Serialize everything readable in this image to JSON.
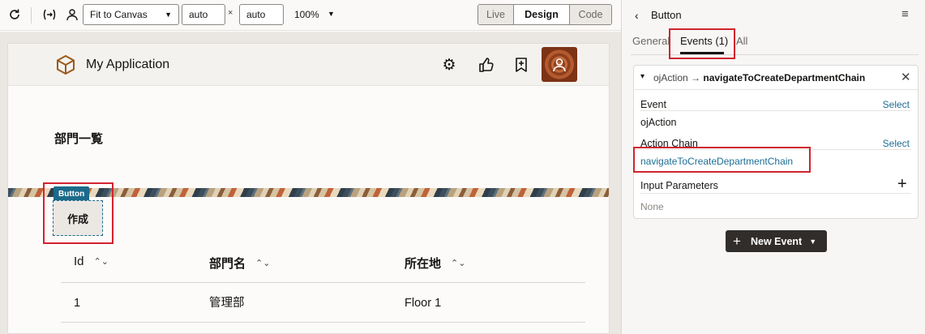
{
  "toolbar": {
    "fit_mode": "Fit to Canvas",
    "width_value": "auto",
    "height_value": "auto",
    "times_symbol": "×",
    "zoom": "100%",
    "modes": [
      "Live",
      "Design",
      "Code"
    ],
    "active_mode": "Design"
  },
  "app": {
    "title": "My Application",
    "page_heading": "部門一覧",
    "button_tag": "Button",
    "create_button": "作成",
    "table": {
      "columns": [
        "Id",
        "部門名",
        "所在地"
      ],
      "rows": [
        [
          "1",
          "管理部",
          "Floor 1"
        ]
      ]
    }
  },
  "panel": {
    "title": "Button",
    "tabs": [
      "General",
      "Events (1)",
      "All"
    ],
    "active_tab": "Events (1)",
    "event_card": {
      "event_prefix": "ojAction →",
      "event_chain": "navigateToCreateDepartmentChain",
      "event_label": "Event",
      "event_select": "Select",
      "event_value": "ojAction",
      "chain_label": "Action Chain",
      "chain_select": "Select",
      "chain_value": "navigateToCreateDepartmentChain",
      "params_label": "Input Parameters",
      "params_value": "None"
    },
    "new_event_button": "New Event"
  },
  "colors": {
    "highlight": "#d1242f",
    "link": "#1b6e95",
    "tag": "#1c6a8a",
    "dark_button": "#312d2a"
  }
}
